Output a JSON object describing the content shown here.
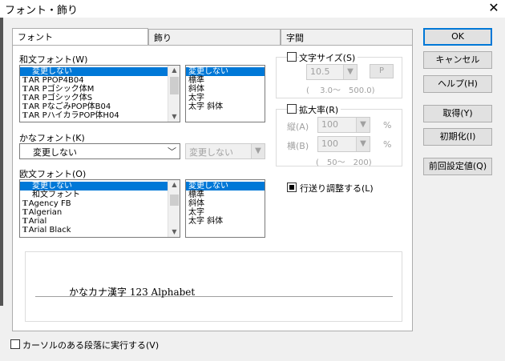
{
  "window": {
    "title": "フォント・飾り",
    "close_glyph": "✕"
  },
  "tabs": [
    {
      "label": "フォント"
    },
    {
      "label": "飾り"
    },
    {
      "label": "字間"
    }
  ],
  "japanese_font": {
    "label": "和文フォント(W)",
    "items": [
      "変更しない",
      "AR PPOP4B04",
      "AR Pゴシック体M",
      "AR Pゴシック体S",
      "AR PなごみPOP体B04",
      "AR PハイカラPOP体H04"
    ],
    "styles": [
      "変更しない",
      "標準",
      "斜体",
      "太字",
      "太字 斜体"
    ]
  },
  "kana_font": {
    "label": "かなフォント(K)",
    "value": "変更しない",
    "style_value": "変更しない"
  },
  "western_font": {
    "label": "欧文フォント(O)",
    "items": [
      "変更しない",
      "和文フォント",
      "Agency FB",
      "Algerian",
      "Arial",
      "Arial Black"
    ],
    "styles": [
      "変更しない",
      "標準",
      "斜体",
      "太字",
      "太字 斜体"
    ]
  },
  "font_size": {
    "label": "文字サイズ(S)",
    "value": "10.5",
    "unit_button": "P",
    "range": "(　 3.0〜　500.0)"
  },
  "scale": {
    "label": "拡大率(R)",
    "vertical_label": "縦(A)",
    "vertical_value": "100",
    "horizontal_label": "横(B)",
    "horizontal_value": "100",
    "percent": "%",
    "range": "(　50〜　200)"
  },
  "line_feed": {
    "label": "行送り調整する(L)"
  },
  "preview": {
    "text": "かなカナ漢字 123 Alphabet"
  },
  "cursor_paragraph": {
    "label": "カーソルのある段落に実行する(V)"
  },
  "buttons": {
    "ok": "OK",
    "cancel": "キャンセル",
    "help": "ヘルプ(H)",
    "get": "取得(Y)",
    "reset": "初期化(I)",
    "previous": "前回設定値(Q)"
  }
}
